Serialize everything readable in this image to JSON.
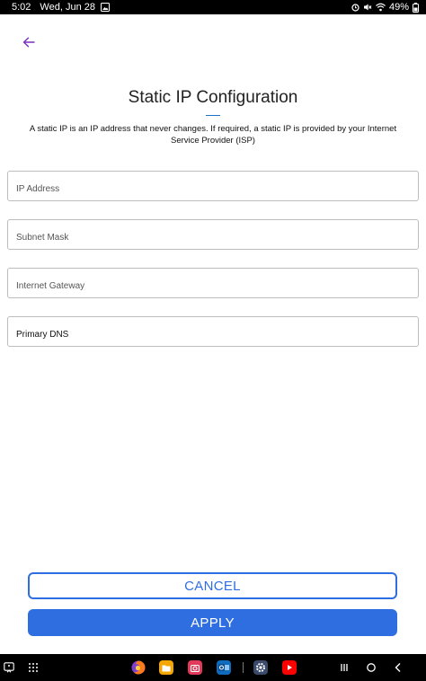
{
  "status_bar": {
    "time": "5:02",
    "date": "Wed, Jun 28",
    "battery": "49%",
    "icons": [
      "image-icon",
      "alarm-icon",
      "mute-icon",
      "wifi-icon",
      "battery-icon"
    ]
  },
  "header": {
    "back_icon": "arrow-left-icon",
    "title": "Static IP Configuration",
    "description": "A static IP is an IP address that never changes. If required, a static IP is provided by your Internet Service Provider (ISP)"
  },
  "form": {
    "fields": [
      {
        "placeholder": "IP Address",
        "value": ""
      },
      {
        "placeholder": "Subnet Mask",
        "value": ""
      },
      {
        "placeholder": "Internet Gateway",
        "value": ""
      },
      {
        "placeholder": "Primary DNS",
        "value": ""
      }
    ]
  },
  "actions": {
    "cancel_label": "CANCEL",
    "apply_label": "APPLY"
  },
  "colors": {
    "accent": "#2f6ee0",
    "back_arrow": "#7b2fbf",
    "underline": "#1a73c8"
  },
  "taskbar": {
    "left_icons": [
      "accessibility-icon",
      "app-drawer-icon"
    ],
    "apps": [
      "firefox-icon",
      "files-icon",
      "camera-icon",
      "outlook-icon",
      "settings-icon",
      "youtube-icon"
    ],
    "nav": [
      "recents-icon",
      "home-icon",
      "back-icon"
    ]
  }
}
